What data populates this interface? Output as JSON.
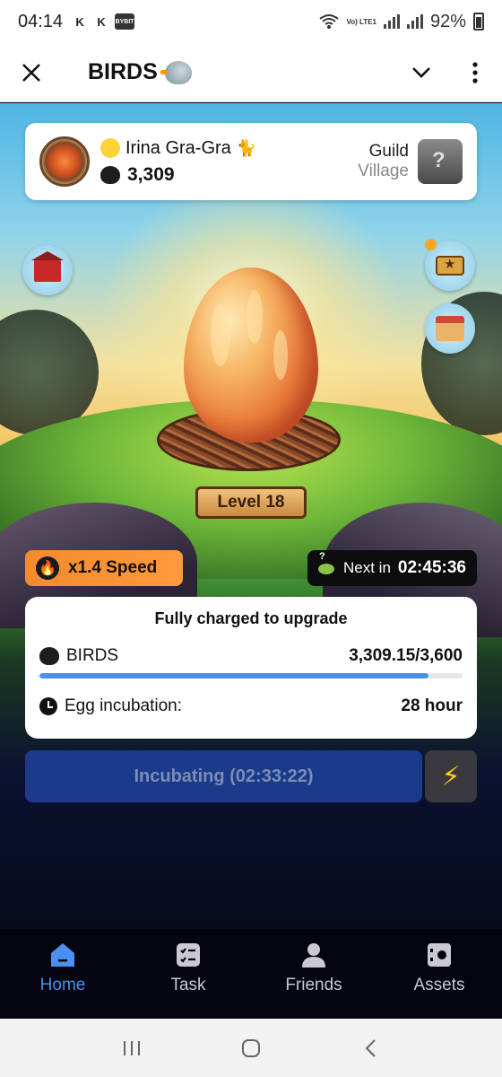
{
  "status_bar": {
    "time": "04:14",
    "battery": "92%",
    "volte": "Vo) LTE1",
    "icons": [
      "k-icon",
      "k-icon",
      "bybit-icon",
      "wifi-icon",
      "signal-icon",
      "signal-icon",
      "battery-icon"
    ]
  },
  "header": {
    "title": "BIRDS",
    "title_icon": "bird-icon"
  },
  "user": {
    "name": "Irina Gra-Gra",
    "balance": "3,309",
    "guild_label": "Guild",
    "guild_name": "Village"
  },
  "egg": {
    "level": "Level 18"
  },
  "speed": {
    "label": "x1.4 Speed"
  },
  "next": {
    "label": "Next in",
    "time": "02:45:36"
  },
  "upgrade": {
    "title": "Fully charged to upgrade",
    "token_label": "BIRDS",
    "token_value": "3,309.15/3,600",
    "progress": 0.919,
    "incubation_label": "Egg incubation:",
    "incubation_value": "28 hour"
  },
  "actions": {
    "incubate_label": "Incubating (02:33:22)",
    "boost_icon": "lightning-icon"
  },
  "nav": {
    "items": [
      {
        "label": "Home",
        "icon": "home-icon",
        "active": true
      },
      {
        "label": "Task",
        "icon": "task-icon",
        "active": false
      },
      {
        "label": "Friends",
        "icon": "friends-icon",
        "active": false
      },
      {
        "label": "Assets",
        "icon": "assets-icon",
        "active": false
      }
    ]
  },
  "colors": {
    "accent": "#4b8ff0",
    "speed_pill": "#f58a2d",
    "incubate_button": "#1b3a8c",
    "progress_fill": "#4d8fe8"
  }
}
